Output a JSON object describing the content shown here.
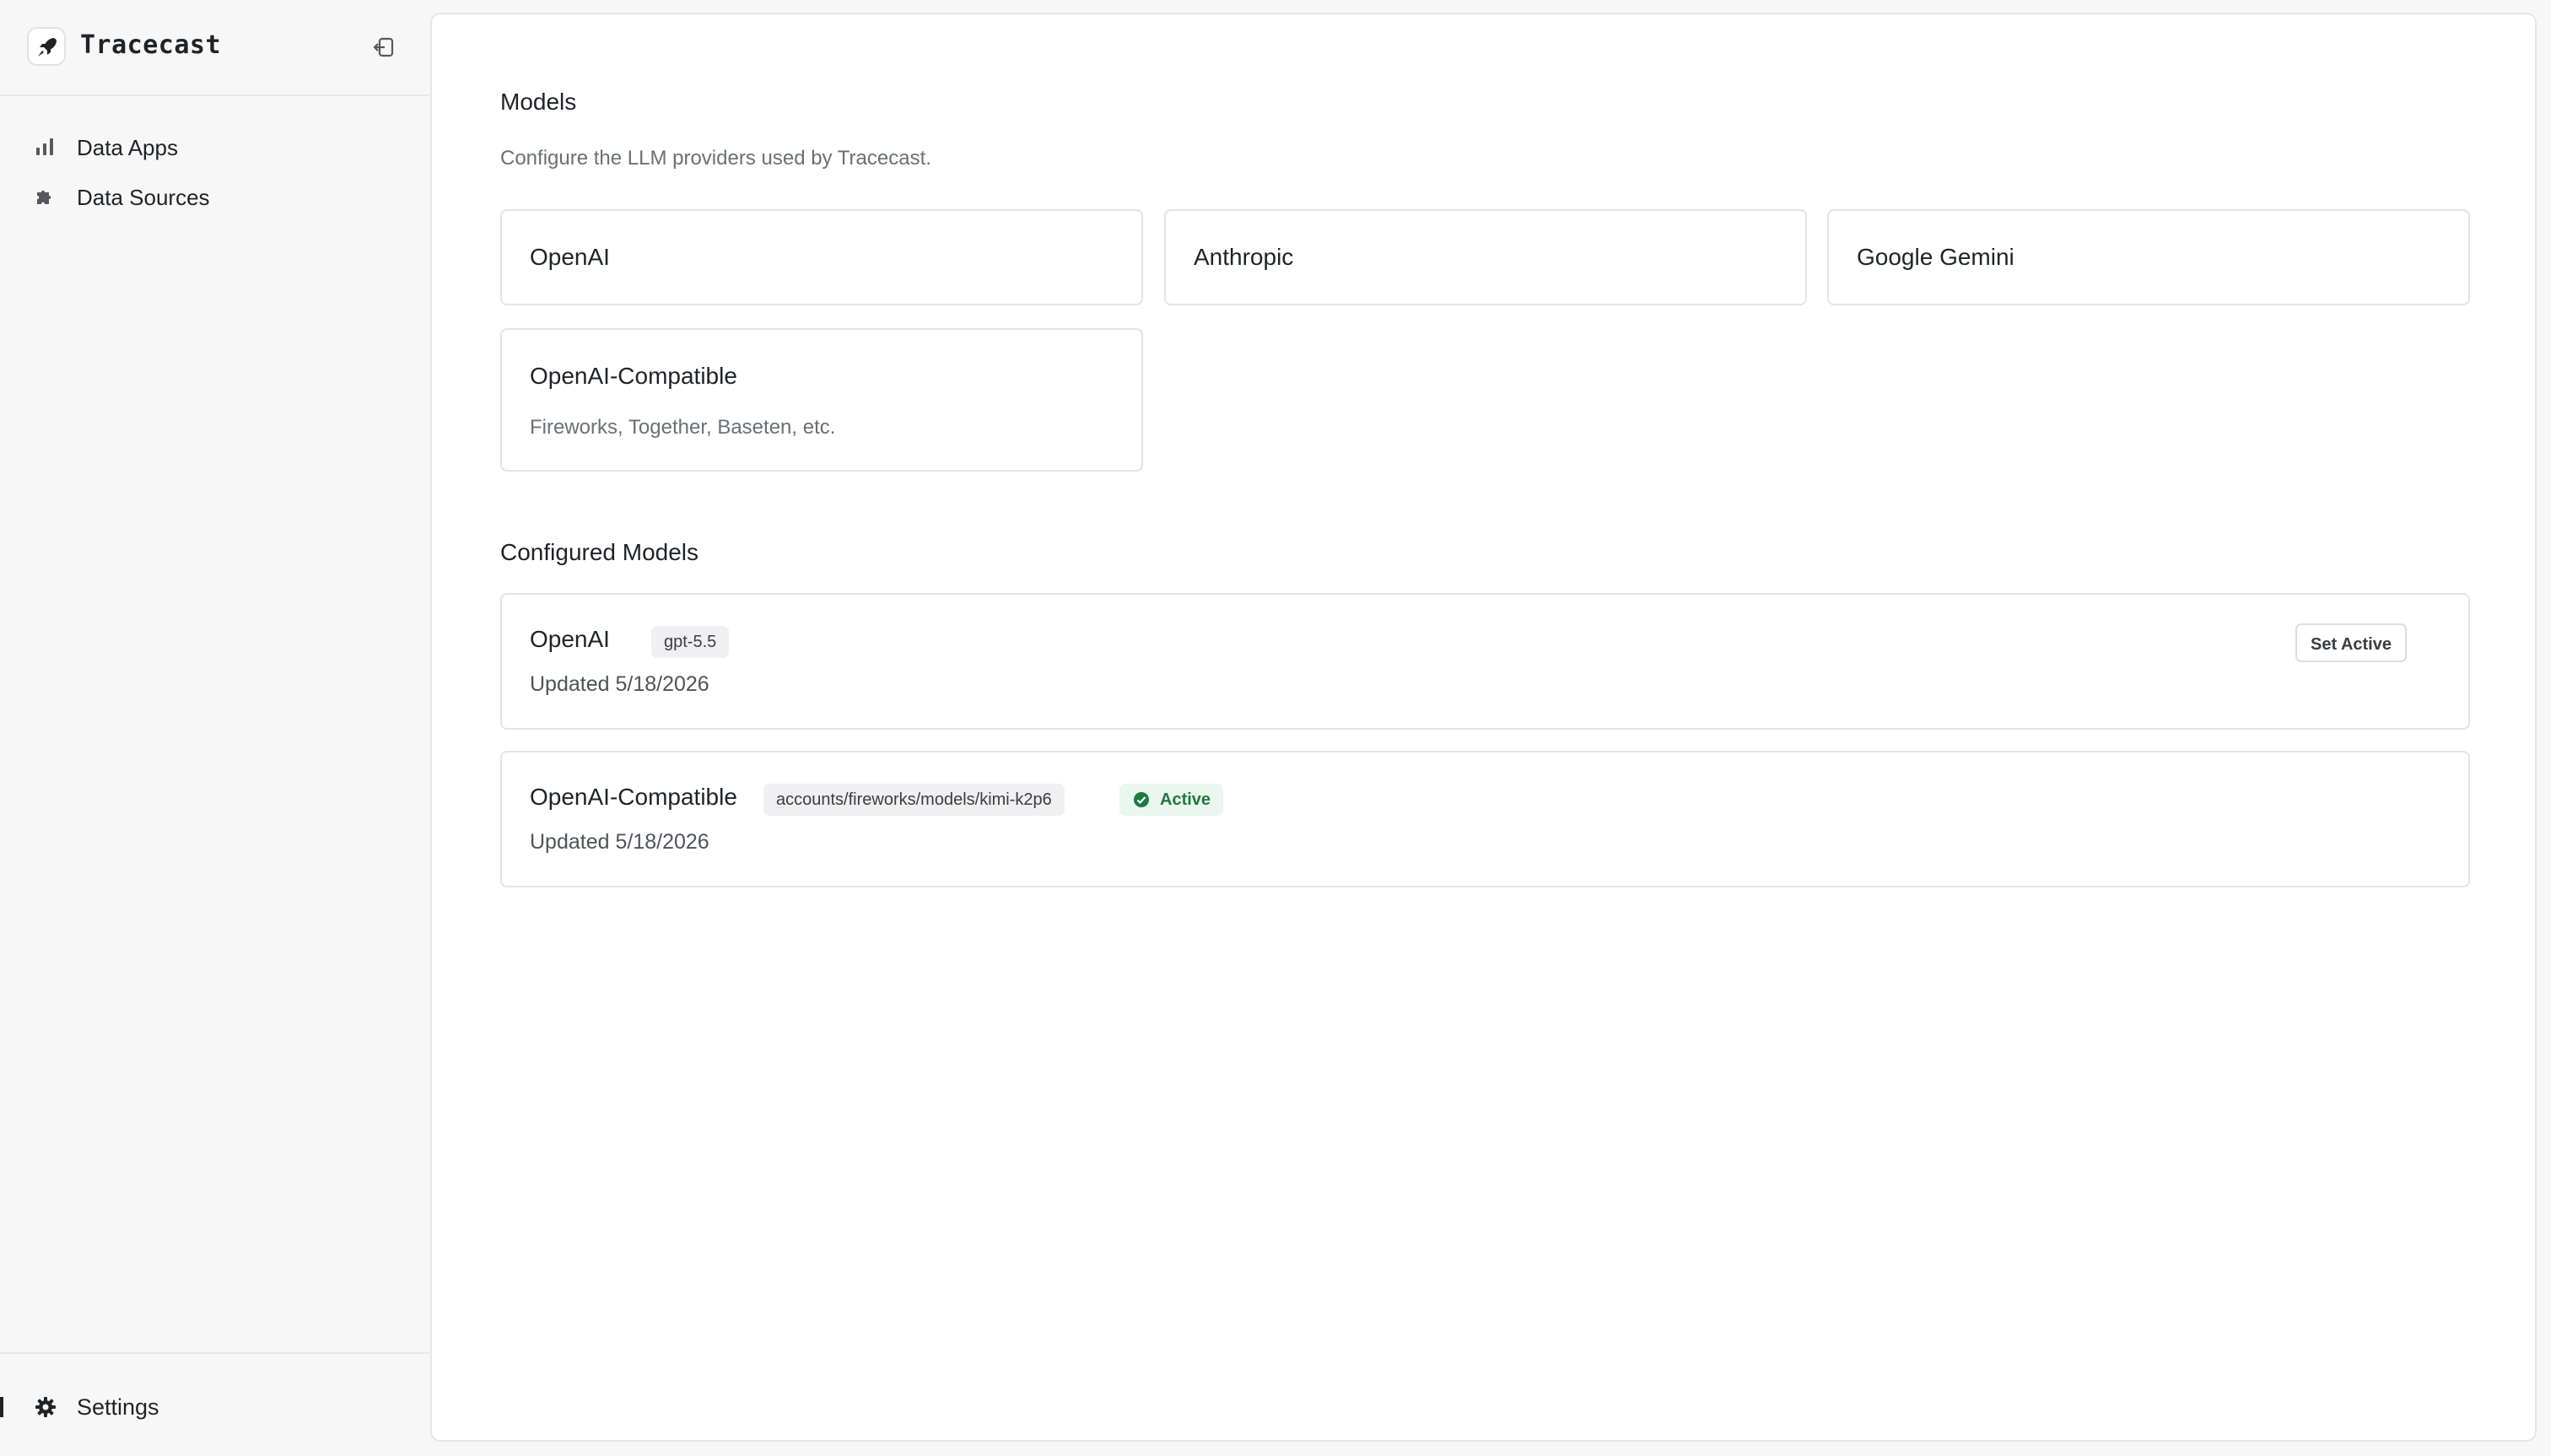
{
  "app": {
    "name": "Tracecast",
    "logo_icon": "rocket-logo-icon",
    "collapse_icon": "sidebar-collapse-icon"
  },
  "sidebar": {
    "items": [
      {
        "label": "Data Apps",
        "icon": "bar-chart-icon"
      },
      {
        "label": "Data Sources",
        "icon": "puzzle-icon"
      }
    ],
    "footer": {
      "label": "Settings",
      "icon": "gear-icon"
    }
  },
  "main": {
    "title": "Models",
    "subtitle": "Configure the LLM providers used by Tracecast.",
    "providers": [
      {
        "name": "OpenAI"
      },
      {
        "name": "Anthropic"
      },
      {
        "name": "Google Gemini"
      },
      {
        "name": "OpenAI-Compatible",
        "description": "Fireworks, Together, Baseten, etc."
      }
    ],
    "configured_title": "Configured Models",
    "configured": [
      {
        "provider": "OpenAI",
        "model": "gpt-5.5",
        "updated": "Updated 5/18/2026",
        "action_label": "Set Active"
      },
      {
        "provider": "OpenAI-Compatible",
        "model": "accounts/fireworks/models/kimi-k2p6",
        "updated": "Updated 5/18/2026",
        "status": "Active",
        "status_icon": "check-circle-icon"
      }
    ]
  },
  "colors": {
    "background": "#f7f7f8",
    "panel": "#ffffff",
    "border": "#e4e4e7",
    "text": "#1f2328",
    "muted": "#6b6f76",
    "active_bg": "#eaf6ee",
    "active_text": "#1e7a3e"
  }
}
